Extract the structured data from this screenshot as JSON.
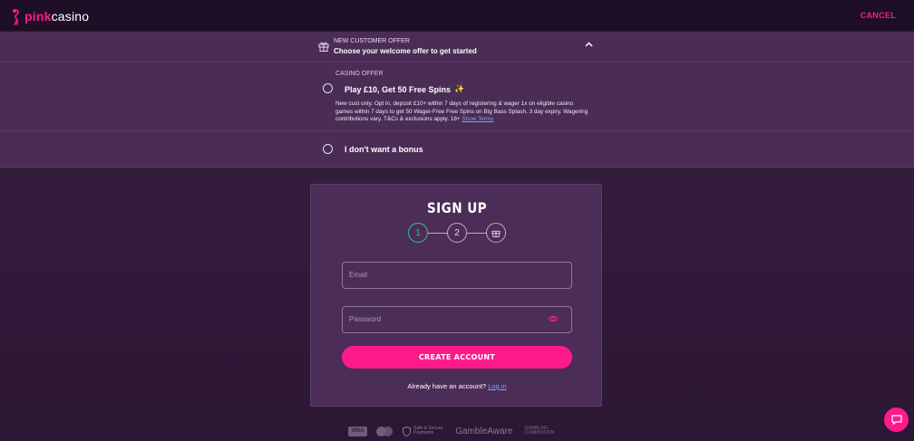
{
  "header": {
    "logo_pink": "pink",
    "logo_casino": "casino",
    "cancel_label": "CANCEL"
  },
  "offer_banner": {
    "kicker": "NEW CUSTOMER OFFER",
    "title": "Choose your welcome offer to get started",
    "icon": "gift-icon",
    "toggle_icon": "chevron-up-icon"
  },
  "offers": {
    "casino": {
      "label": "CASINO OFFER",
      "name": "Play £10, Get 50 Free Spins",
      "emoji": "✨",
      "terms": "New cust only. Opt in, deposit £10+ within 7 days of registering & wager 1x on eligible casino games within 7 days to get 50 Wager-Free Free Spins on Big Bass Splash. 3 day expiry. Wagering contributions vary. T&Cs & exclusions apply. 18+",
      "terms_link": "Show Terms"
    },
    "no_bonus": {
      "name": "I don't want a bonus"
    }
  },
  "signup": {
    "title": "SIGN UP",
    "steps": [
      "1",
      "2"
    ],
    "email_placeholder": "Email",
    "password_placeholder": "Password",
    "submit_label": "CREATE ACCOUNT",
    "login_prompt": "Already have an account?",
    "login_link": "Log in"
  },
  "footer": {
    "visa": "VISA",
    "safe_line1": "Safe & Secure",
    "safe_line2": "Payments",
    "gamble_aware": "GambleAware",
    "commission_line1": "GAMBLING",
    "commission_line2": "COMMISSION"
  },
  "colors": {
    "brand_pink": "#ff1a8c",
    "step_active": "#36c38a",
    "link": "#7aa7ff"
  }
}
